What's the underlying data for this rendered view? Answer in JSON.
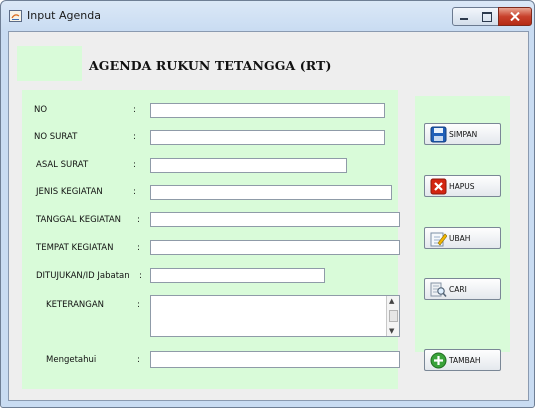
{
  "window": {
    "title": "Input Agenda",
    "buttons": [
      "minimize",
      "maximize",
      "close"
    ]
  },
  "header": {
    "title": "AGENDA RUKUN TETANGGA (RT)"
  },
  "form": {
    "colon": ":",
    "fields": [
      {
        "label": "NO",
        "value": ""
      },
      {
        "label": "NO SURAT",
        "value": ""
      },
      {
        "label": "ASAL SURAT",
        "value": ""
      },
      {
        "label": "JENIS KEGIATAN",
        "value": ""
      },
      {
        "label": "TANGGAL KEGIATAN",
        "value": ""
      },
      {
        "label": "TEMPAT KEGIATAN",
        "value": ""
      },
      {
        "label": "DITUJUKAN/ID Jabatan",
        "value": ""
      },
      {
        "label": "KETERANGAN",
        "value": ""
      },
      {
        "label": "Mengetahui",
        "value": ""
      }
    ]
  },
  "actions": {
    "simpan": {
      "label": "SIMPAN",
      "icon": "save-icon"
    },
    "hapus": {
      "label": "HAPUS",
      "icon": "delete-icon"
    },
    "ubah": {
      "label": "UBAH",
      "icon": "edit-icon"
    },
    "cari": {
      "label": "CARI",
      "icon": "search-icon"
    },
    "tambah": {
      "label": "TAMBAH",
      "icon": "add-icon"
    }
  },
  "colors": {
    "panel_green": "#d9fbd9",
    "window_frame": "#c9dcf2",
    "close_red": "#c8412c"
  }
}
